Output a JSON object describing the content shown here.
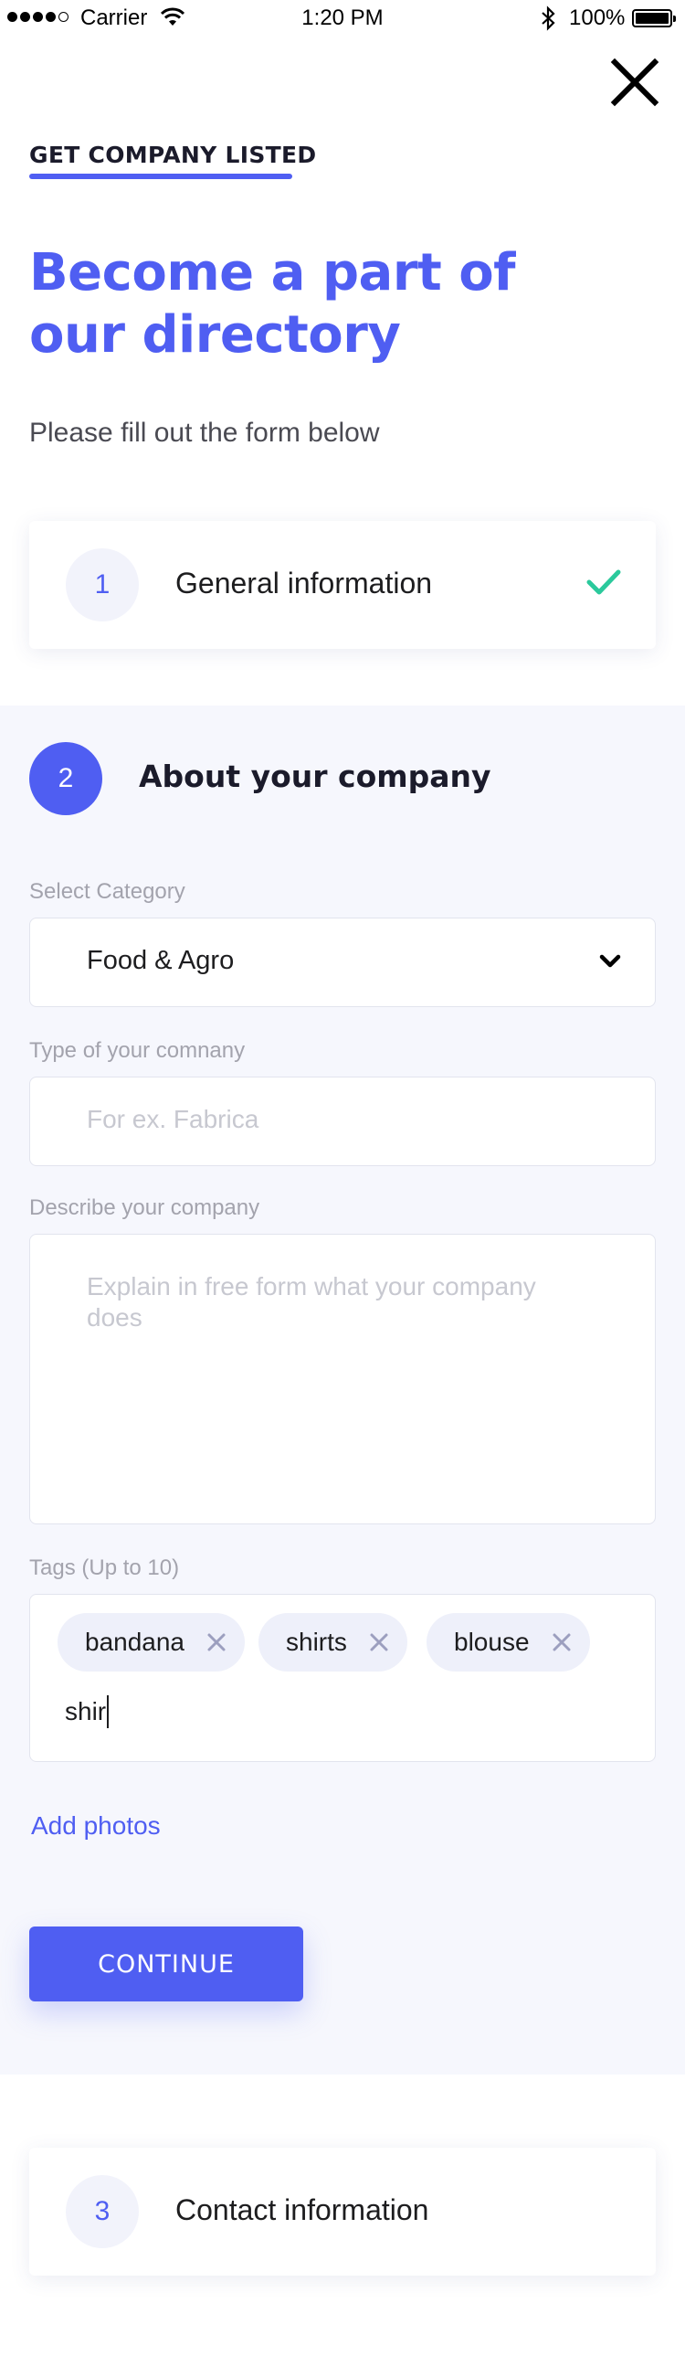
{
  "status_bar": {
    "carrier": "Carrier",
    "time": "1:20 PM",
    "battery": "100%"
  },
  "header": {
    "eyebrow": "GET COMPANY LISTED",
    "title": "Become a part of our directory",
    "subtitle": "Please fill out the form below"
  },
  "steps": [
    {
      "number": "1",
      "title": "General information",
      "status": "completed"
    },
    {
      "number": "2",
      "title": "About your company",
      "status": "active"
    },
    {
      "number": "3",
      "title": "Contact information",
      "status": "pending"
    }
  ],
  "form": {
    "category": {
      "label": "Select Category",
      "value": "Food & Agro"
    },
    "type": {
      "label": "Type of your comnany",
      "placeholder": "For ex. Fabrica"
    },
    "description": {
      "label": "Describe your company",
      "placeholder": "Explain in free form what your company does"
    },
    "tags": {
      "label": "Tags (Up to 10)",
      "items": [
        "bandana",
        "shirts",
        "blouse"
      ],
      "input_value": "shir"
    },
    "add_photos": "Add photos",
    "continue": "CONTINUE"
  },
  "colors": {
    "accent": "#4f5ef2",
    "check": "#2bc99c",
    "section_bg": "#f6f7fd"
  },
  "icons": {
    "close": "close-icon",
    "check": "check-icon",
    "chevron": "chevron-down-icon",
    "tag_remove": "tag-remove-icon"
  }
}
